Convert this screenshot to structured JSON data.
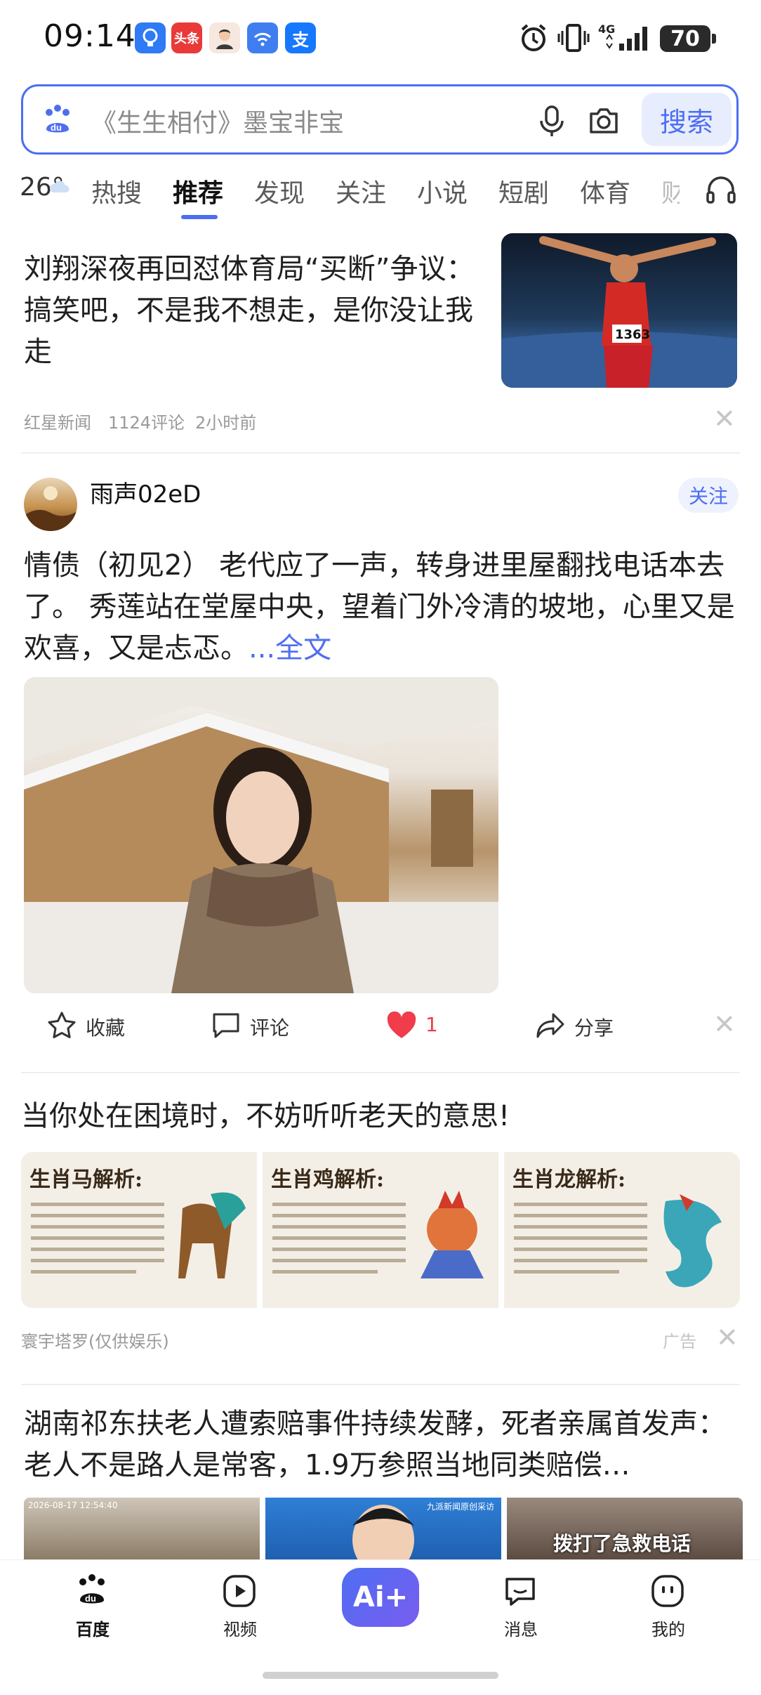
{
  "status_bar": {
    "time": "09:14",
    "app_icons": [
      "bulb-icon",
      "toutiao-icon",
      "avatar-icon",
      "wifi-assist-icon",
      "alipay-icon"
    ],
    "toutiao_label": "头条",
    "alipay_label": "支",
    "network": "4G",
    "battery": "70"
  },
  "search": {
    "placeholder": "《生生相付》墨宝非宝",
    "button_label": "搜索"
  },
  "weather": {
    "temp": "26°"
  },
  "tabs": [
    {
      "label": "热搜"
    },
    {
      "label": "推荐"
    },
    {
      "label": "发现"
    },
    {
      "label": "关注"
    },
    {
      "label": "小说"
    },
    {
      "label": "短剧"
    },
    {
      "label": "体育"
    },
    {
      "label": "财"
    }
  ],
  "feed": {
    "item1": {
      "title": "刘翔深夜再回怼体育局“买断”争议：搞笑吧，不是我不想走，是你没让我走",
      "source": "红星新闻",
      "comments": "1124评论",
      "time": "2小时前",
      "image_text": "1363"
    },
    "item2": {
      "author": "雨声02eD",
      "follow_label": "关注",
      "text": "情债（初见2） 老代应了一声，转身进里屋翻找电话本去了。 秀莲站在堂屋中央，望着门外冷清的坡地，心里又是欢喜，又是忐忑。",
      "more_label": "...全文",
      "actions": {
        "favorite": "收藏",
        "comment": "评论",
        "likes": "1",
        "share": "分享"
      }
    },
    "item3": {
      "title": "当你处在困境时，不妨听听老天的意思!",
      "images": [
        {
          "heading": "生肖马解析:"
        },
        {
          "heading": "生肖鸡解析:"
        },
        {
          "heading": "生肖龙解析:"
        }
      ],
      "source": "寰宇塔罗(仅供娱乐)",
      "ad_label": "广告"
    },
    "item4": {
      "title": "湖南祁东扶老人遭索赔事件持续发酵，死者亲属首发声：老人不是路人是常客，1.9万参照当地同类赔偿…",
      "image1_stamp": "2026-08-17 12:54:40",
      "image2_caption": "九派新闻原创采访",
      "image3_caption": "拨打了急救电话"
    }
  },
  "bottom_nav": {
    "home": "百度",
    "video": "视频",
    "ai": "Ai+",
    "messages": "消息",
    "me": "我的"
  },
  "colors": {
    "brand_blue": "#4e6ef2",
    "like_red": "#f03c4b"
  }
}
